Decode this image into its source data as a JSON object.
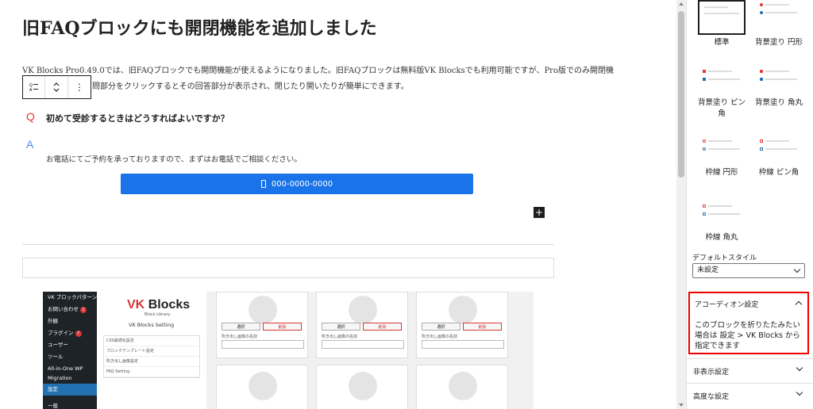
{
  "post": {
    "title": "旧FAQブロックにも開閉機能を追加しました",
    "paragraph_line1": "VK Blocks Pro0.49.0では、旧FAQブロックでも開閉機能が使えるようになりました。旧FAQブロックは無料版VK Blocksでも利用可能ですが、Pro版でのみ開閉機",
    "paragraph_line2": "問部分をクリックするとその回答部分が表示され、閉じたり開いたりが簡単にできます。"
  },
  "block_toolbar": {
    "block_icon": "faq-block-icon",
    "move_icon": "move-up-down-icon",
    "more_icon": "⋮"
  },
  "faq": {
    "q_mark": "Q",
    "question": "初めて受診するときはどうすればよいですか？",
    "a_mark": "A",
    "answer": "お電話にてご予約を承っておりますので、まずはお電話でご相談ください。",
    "phone_button": "000-0000-0000"
  },
  "inserter": {
    "label": "+"
  },
  "screenshot": {
    "menu": [
      "VK ブロックパターン",
      "お問い合わせ",
      "外観",
      "プラグイン",
      "ユーザー",
      "ツール",
      "All-in-One WP Migration",
      "設定",
      "一般"
    ],
    "contact_badge": "1",
    "plugin_badge": "7",
    "vk_logo_vk": "VK",
    "vk_logo_blocks": "Blocks",
    "vk_logo_sub": "Block Library",
    "vk_setting_title": "VK Blocks Setting",
    "vk_setting_list": [
      "CSS最適化設定",
      "ブロックテンプレート設定",
      "吹き出し画像設定",
      "FAQ Setting"
    ],
    "select_label": "選択",
    "delete_label": "削除",
    "balloon_name_label": "吹き出し画像の名前"
  },
  "sidebar": {
    "styles": [
      {
        "name": "標準",
        "selected": true
      },
      {
        "name": "背景塗り 円形",
        "selected": false
      },
      {
        "name": "背景塗り ピン角",
        "selected": false
      },
      {
        "name": "背景塗り 角丸",
        "selected": false
      },
      {
        "name": "枠線 円形",
        "selected": false
      },
      {
        "name": "枠線 ピン角",
        "selected": false
      },
      {
        "name": "枠線 角丸",
        "selected": false
      }
    ],
    "default_style_label": "デフォルトスタイル",
    "default_style_value": "未設定",
    "accordion_title": "アコーディオン設定",
    "accordion_text": "このブロックを折りたたみたい場合は 設定 > VK Blocks から指定できます",
    "hidden_settings": "非表示設定",
    "advanced_settings": "高度な設定"
  },
  "colors": {
    "question_red": "#e53935",
    "answer_blue": "#4a90e2",
    "button_blue": "#1a73e8",
    "highlight_red": "#ee0000"
  }
}
